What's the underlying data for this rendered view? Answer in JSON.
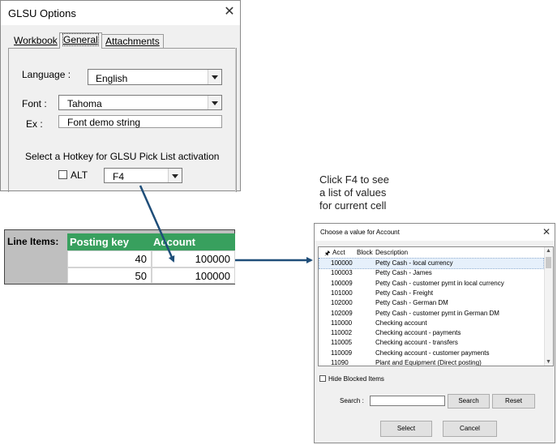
{
  "options_dialog": {
    "title": "GLSU Options",
    "close_glyph": "✕",
    "tabs": [
      {
        "label": "Workbook"
      },
      {
        "label": "General",
        "active": true
      },
      {
        "label": "Attachments"
      }
    ],
    "language": {
      "label": "Language :",
      "value": "English"
    },
    "font": {
      "label": "Font :",
      "value": "Tahoma"
    },
    "example": {
      "label": "Ex :",
      "value": "Font demo string"
    },
    "hotkey": {
      "label": "Select a Hotkey for GLSU Pick List activation",
      "alt_label": "ALT",
      "alt_checked": false,
      "key_value": "F4"
    }
  },
  "sheet": {
    "row_label": "Line Items:",
    "columns": [
      "Posting key",
      "Account"
    ],
    "rows": [
      [
        "40",
        "100000"
      ],
      [
        "50",
        "100000"
      ]
    ],
    "header_color": "#38a05e"
  },
  "note": {
    "lines": [
      "Click F4 to see",
      "a list of values",
      "for current cell"
    ]
  },
  "picklist_dialog": {
    "title": "Choose a value for Account",
    "close_glyph": "✕",
    "columns": {
      "pin": "🖈",
      "acct": "Acct",
      "block": "Block",
      "desc": "Description"
    },
    "rows": [
      {
        "acct": "100000",
        "desc": "Petty Cash - local currency",
        "selected": true
      },
      {
        "acct": "100003",
        "desc": "Petty Cash - James"
      },
      {
        "acct": "100009",
        "desc": "Petty Cash - customer pymt in local currency"
      },
      {
        "acct": "101000",
        "desc": "Petty Cash - Freight"
      },
      {
        "acct": "102000",
        "desc": "Petty Cash - German DM"
      },
      {
        "acct": "102009",
        "desc": "Petty Cash - customer pymt in German DM"
      },
      {
        "acct": "110000",
        "desc": "Checking account"
      },
      {
        "acct": "110002",
        "desc": "Checking account - payments"
      },
      {
        "acct": "110005",
        "desc": "Checking account - transfers"
      },
      {
        "acct": "110009",
        "desc": "Checking account - customer payments"
      },
      {
        "acct": "11090",
        "desc": "Plant and Equipment (Direct posting)"
      }
    ],
    "hide_blocked": {
      "label": "Hide Blocked Items",
      "checked": false
    },
    "search": {
      "label": "Search :",
      "value": "",
      "search_button": "Search",
      "reset_button": "Reset"
    },
    "select_button": "Select",
    "cancel_button": "Cancel"
  },
  "colors": {
    "arrow": "#1f4e79",
    "selection": "#e6f0fb",
    "sheet_header": "#38a05e"
  },
  "icons": {
    "close": "close-icon",
    "dropdown": "chevron-down-icon",
    "pin": "pin-icon",
    "arrow": "arrow-icon"
  }
}
